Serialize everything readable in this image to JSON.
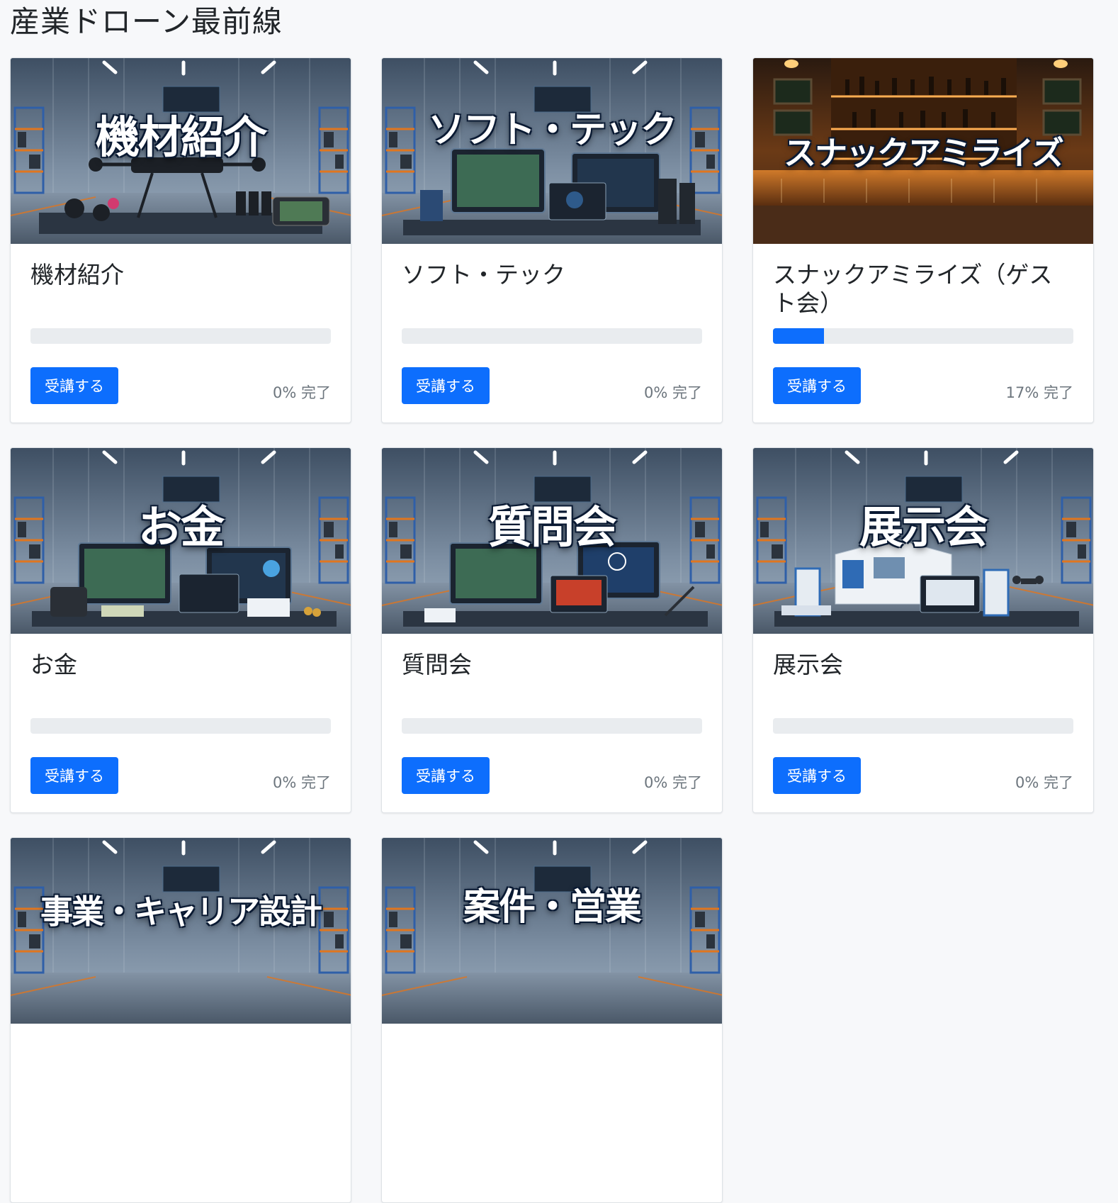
{
  "page": {
    "title": "産業ドローン最前線"
  },
  "colors": {
    "primary": "#0d6efd",
    "track": "#e9ecef",
    "muted": "#6c757d",
    "background": "#f7f8fa"
  },
  "courses": [
    {
      "thumb_text": "機材紹介",
      "title": "機材紹介",
      "progress": 0,
      "status": "0% 完了",
      "button": "受講する",
      "scene": "warehouse-equipment-image"
    },
    {
      "thumb_text": "ソフト・テック",
      "title": "ソフト・テック",
      "progress": 0,
      "status": "0% 完了",
      "button": "受講する",
      "scene": "warehouse-computers-image"
    },
    {
      "thumb_text": "スナックアミライズ",
      "title": "スナックアミライズ（ゲスト会）",
      "progress": 17,
      "status": "17% 完了",
      "button": "受講する",
      "scene": "bar-counter-image"
    },
    {
      "thumb_text": "お金",
      "title": "お金",
      "progress": 0,
      "status": "0% 完了",
      "button": "受講する",
      "scene": "warehouse-finance-image"
    },
    {
      "thumb_text": "質問会",
      "title": "質問会",
      "progress": 0,
      "status": "0% 完了",
      "button": "受講する",
      "scene": "warehouse-qa-image"
    },
    {
      "thumb_text": "展示会",
      "title": "展示会",
      "progress": 0,
      "status": "0% 完了",
      "button": "受講する",
      "scene": "warehouse-expo-image"
    },
    {
      "thumb_text": "事業・キャリア設計",
      "scene": "warehouse-career-image"
    },
    {
      "thumb_text": "案件・営業",
      "scene": "warehouse-sales-image"
    }
  ]
}
